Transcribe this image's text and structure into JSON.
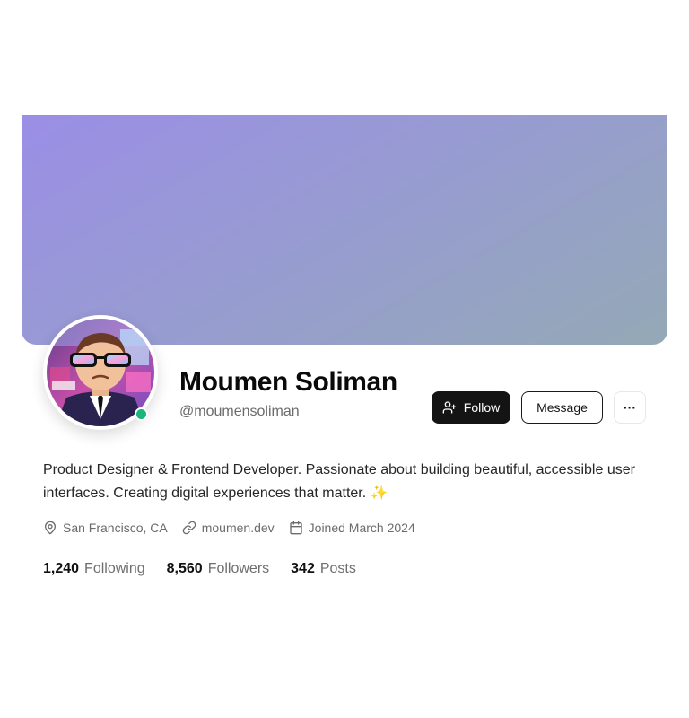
{
  "profile": {
    "name": "Moumen Soliman",
    "handle": "@moumensoliman",
    "online": true,
    "bio": "Product Designer & Frontend Developer. Passionate about building beautiful, accessible user interfaces. Creating digital experiences that matter. ✨"
  },
  "actions": {
    "follow_label": "Follow",
    "message_label": "Message",
    "more_label": "···"
  },
  "meta": {
    "location": "San Francisco, CA",
    "website": "moumen.dev",
    "joined": "Joined March 2024"
  },
  "stats": [
    {
      "value": "1,240",
      "label": "Following"
    },
    {
      "value": "8,560",
      "label": "Followers"
    },
    {
      "value": "342",
      "label": "Posts"
    }
  ],
  "icons": {
    "follow": "user-plus-icon",
    "location": "map-pin-icon",
    "website": "link-icon",
    "joined": "calendar-icon",
    "more": "more-horizontal-icon"
  },
  "colors": {
    "cover_start": "#9b8ee6",
    "cover_end": "#94a9b6",
    "online_status": "#19b57a",
    "primary_button": "#141414"
  }
}
